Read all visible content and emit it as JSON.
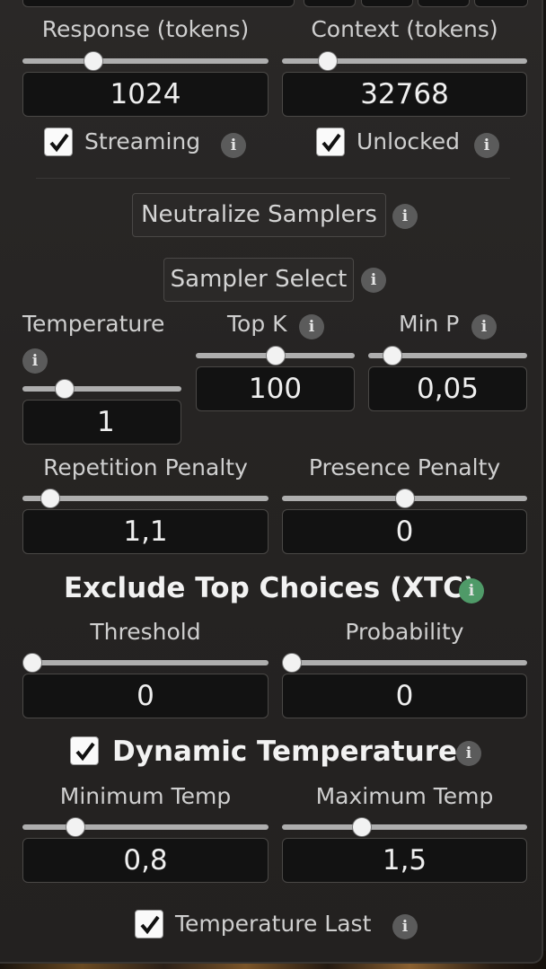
{
  "response": {
    "label": "Response (tokens)",
    "value": "1024",
    "level": 0.27
  },
  "context": {
    "label": "Context (tokens)",
    "value": "32768",
    "level": 0.16
  },
  "streaming": {
    "label": "Streaming",
    "checked": true
  },
  "unlocked": {
    "label": "Unlocked",
    "checked": true
  },
  "neutralize_label": "Neutralize Samplers",
  "sampler_select_label": "Sampler Select",
  "temperature": {
    "label": "Temperature",
    "value": "1",
    "level": 0.23
  },
  "top_k": {
    "label": "Top K",
    "value": "100",
    "level": 0.5
  },
  "min_p": {
    "label": "Min P",
    "value": "0,05",
    "level": 0.1
  },
  "repetition_penalty": {
    "label": "Repetition Penalty",
    "value": "1,1",
    "level": 0.08
  },
  "presence_penalty": {
    "label": "Presence Penalty",
    "value": "0",
    "level": 0.5
  },
  "xtc": {
    "heading": "Exclude Top Choices (XTC)",
    "threshold": {
      "label": "Threshold",
      "value": "0",
      "level": 0.0
    },
    "probability": {
      "label": "Probability",
      "value": "0",
      "level": 0.0
    }
  },
  "dynamic_temperature": {
    "label": "Dynamic Temperature",
    "checked": true,
    "minimum": {
      "label": "Minimum Temp",
      "value": "0,8",
      "level": 0.19
    },
    "maximum": {
      "label": "Maximum Temp",
      "value": "1,5",
      "level": 0.31
    }
  },
  "temperature_last": {
    "label": "Temperature Last",
    "checked": true
  },
  "info_glyph": "i"
}
